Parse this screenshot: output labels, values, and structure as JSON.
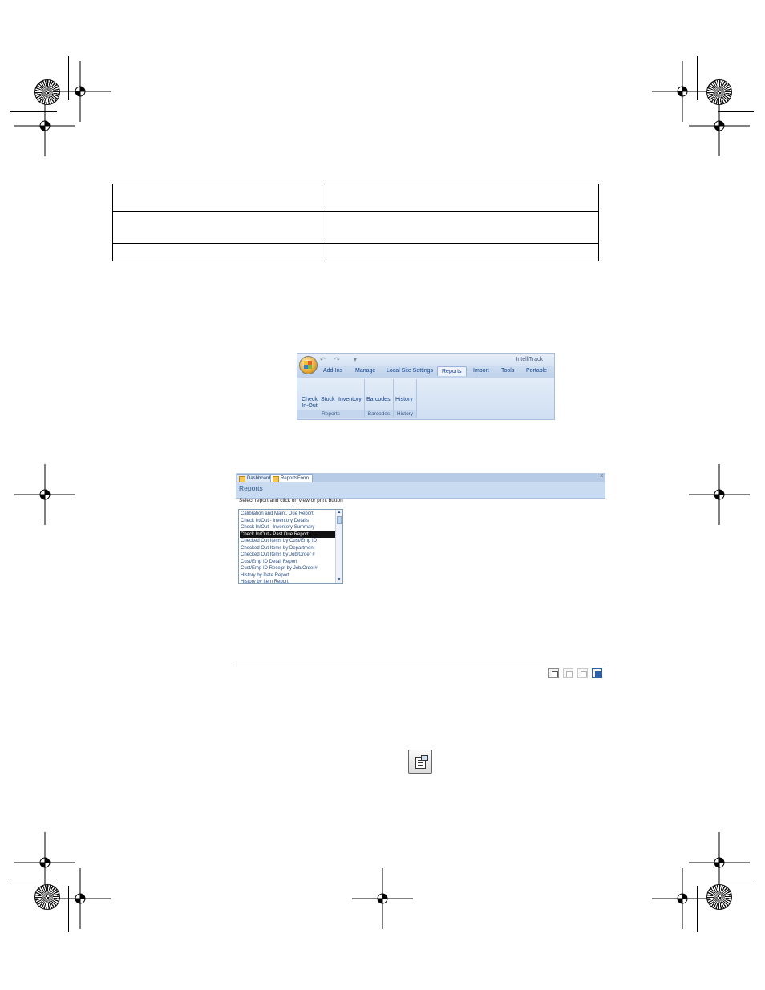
{
  "print_marks": {
    "registration_marks": [
      "reg-top-left-1",
      "reg-top-left-2",
      "reg-top-right-1",
      "reg-top-right-2",
      "reg-mid-left",
      "reg-mid-right",
      "reg-bottom-left-1",
      "reg-bottom-left-2",
      "reg-bottom-center",
      "reg-bottom-right-1",
      "reg-bottom-right-2"
    ],
    "star_targets": [
      "star-top-left",
      "star-top-right",
      "star-bottom-left",
      "star-bottom-right"
    ]
  },
  "top_table": {
    "rows": [
      [
        "",
        ""
      ],
      [
        "",
        ""
      ],
      [
        "",
        ""
      ]
    ]
  },
  "ribbon": {
    "app_title": "IntelliTrack",
    "quick_access": {
      "undo": "↶",
      "redo": "↷",
      "customize": "▾"
    },
    "tabs": [
      {
        "label": "Add-Ins",
        "active": false
      },
      {
        "label": "Manage",
        "active": false
      },
      {
        "label": "Local Site Settings",
        "active": false
      },
      {
        "label": "Reports",
        "active": true
      },
      {
        "label": "Import",
        "active": false
      },
      {
        "label": "Tools",
        "active": false
      },
      {
        "label": "Portable",
        "active": false
      }
    ],
    "groups": [
      {
        "label": "Reports",
        "buttons": [
          "Check In-Out",
          "Stock",
          "Inventory"
        ]
      },
      {
        "label": "Barcodes",
        "buttons": [
          "Barcodes"
        ]
      },
      {
        "label": "History",
        "buttons": [
          "History"
        ]
      }
    ]
  },
  "reports_form": {
    "doc_tabs": [
      {
        "label": "Dashboard",
        "active": false
      },
      {
        "label": "ReportsForm",
        "active": true
      }
    ],
    "close_glyph": "x",
    "title": "Reports",
    "instruction": "Select report and click on view or print button",
    "reports": [
      "Calibration and Maint. Due Report",
      "Check In/Out - Inventory Details",
      "Check In/Out - Inventory Summary",
      "Check In/Out - Past Due Report",
      "Checked Out Items by Cust/Emp ID",
      "Checked Out Items by Department",
      "Checked Out Items by Job/Order #",
      "Cust/Emp ID Detail Report",
      "Cust/Emp ID Receipt by Job/Order#",
      "History by Date Report",
      "History by Item Report"
    ],
    "selected_report": "Check In/Out - Past Due Report",
    "scroll_up": "▲",
    "scroll_down": "▼",
    "footer_buttons": [
      "report-options",
      "preview",
      "print",
      "exit"
    ]
  },
  "standalone_button": "report-options-button"
}
